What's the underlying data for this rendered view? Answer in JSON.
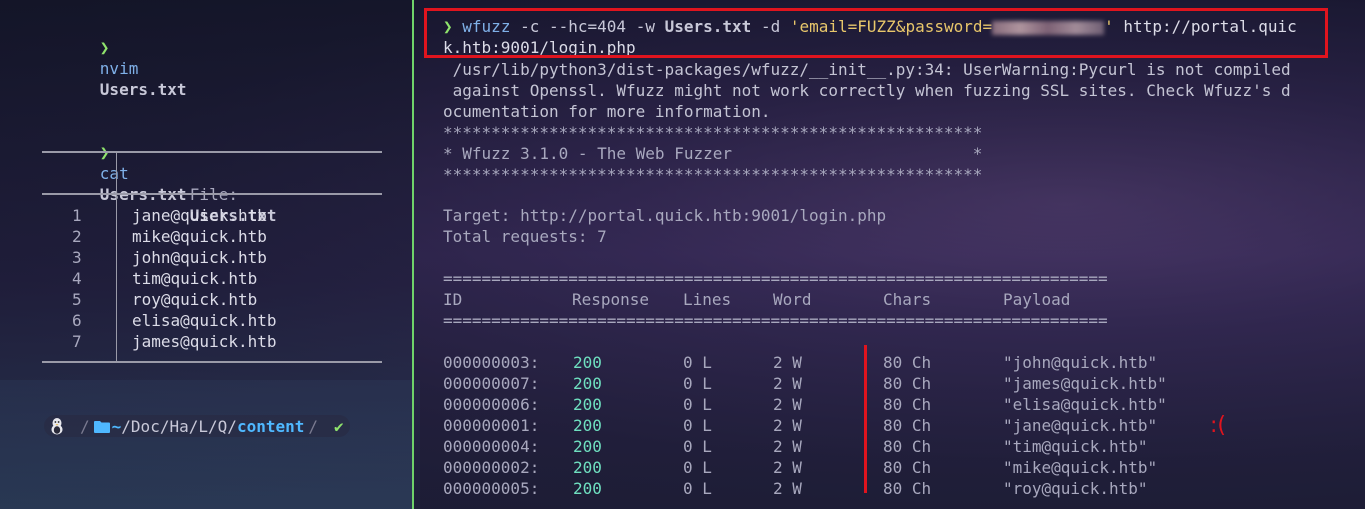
{
  "left": {
    "cmd1": {
      "prompt": "❯",
      "program": "nvim",
      "arg": "Users.txt"
    },
    "cmd2": {
      "prompt": "❯",
      "program": "cat",
      "arg": "Users.txt"
    },
    "file_header": {
      "label": "File:",
      "name": "Users.txt"
    },
    "lines": [
      {
        "n": "1",
        "text": "jane@quick.htb"
      },
      {
        "n": "2",
        "text": "mike@quick.htb"
      },
      {
        "n": "3",
        "text": "john@quick.htb"
      },
      {
        "n": "4",
        "text": "tim@quick.htb"
      },
      {
        "n": "5",
        "text": "roy@quick.htb"
      },
      {
        "n": "6",
        "text": "elisa@quick.htb"
      },
      {
        "n": "7",
        "text": "james@quick.htb"
      }
    ],
    "statusbar": {
      "os_icon": "linux-penguin-icon",
      "folder_icon": "folder-icon",
      "home": "~",
      "path_parts": [
        "Doc",
        "Ha",
        "L",
        "Q"
      ],
      "current_dir": "content",
      "status_icon": "check-icon",
      "status_glyph": "✔"
    }
  },
  "right": {
    "cmd": {
      "prompt": "❯",
      "program": "wfuzz",
      "flags1": "-c --hc=404 -w",
      "wordlist": "Users.txt",
      "flag_d": "-d",
      "data_start": "'email=FUZZ&password=",
      "data_end": "'",
      "url_part1": "http://portal.quic",
      "url_part2": "k.htb:9001/login.php"
    },
    "warning": [
      " /usr/lib/python3/dist-packages/wfuzz/__init__.py:34: UserWarning:Pycurl is not compiled",
      " against Openssl. Wfuzz might not work correctly when fuzzing SSL sites. Check Wfuzz's d",
      "ocumentation for more information."
    ],
    "banner": [
      "********************************************************",
      "* Wfuzz 3.1.0 - The Web Fuzzer                         *",
      "********************************************************"
    ],
    "target": "Target: http://portal.quick.htb:9001/login.php",
    "total": "Total requests: 7",
    "rule": "=====================================================================",
    "columns": [
      "ID",
      "Response",
      "Lines",
      "Word",
      "Chars",
      "Payload"
    ],
    "rows": [
      {
        "id": "000000003:",
        "resp": "200",
        "lines": "0 L",
        "word": "2 W",
        "chars": "80 Ch",
        "payload": "\"john@quick.htb\""
      },
      {
        "id": "000000007:",
        "resp": "200",
        "lines": "0 L",
        "word": "2 W",
        "chars": "80 Ch",
        "payload": "\"james@quick.htb\""
      },
      {
        "id": "000000006:",
        "resp": "200",
        "lines": "0 L",
        "word": "2 W",
        "chars": "80 Ch",
        "payload": "\"elisa@quick.htb\""
      },
      {
        "id": "000000001:",
        "resp": "200",
        "lines": "0 L",
        "word": "2 W",
        "chars": "80 Ch",
        "payload": "\"jane@quick.htb\""
      },
      {
        "id": "000000004:",
        "resp": "200",
        "lines": "0 L",
        "word": "2 W",
        "chars": "80 Ch",
        "payload": "\"tim@quick.htb\""
      },
      {
        "id": "000000002:",
        "resp": "200",
        "lines": "0 L",
        "word": "2 W",
        "chars": "80 Ch",
        "payload": "\"mike@quick.htb\""
      },
      {
        "id": "000000005:",
        "resp": "200",
        "lines": "0 L",
        "word": "2 W",
        "chars": "80 Ch",
        "payload": "\"roy@quick.htb\""
      }
    ],
    "annotation": ":("
  },
  "colors": {
    "prompt": "#8fe36c",
    "program": "#7fb0e8",
    "string": "#e8c76b",
    "status_code": "#6fe0c0",
    "annotation_red": "#e0141e",
    "pane_divider": "#6fd36a"
  }
}
